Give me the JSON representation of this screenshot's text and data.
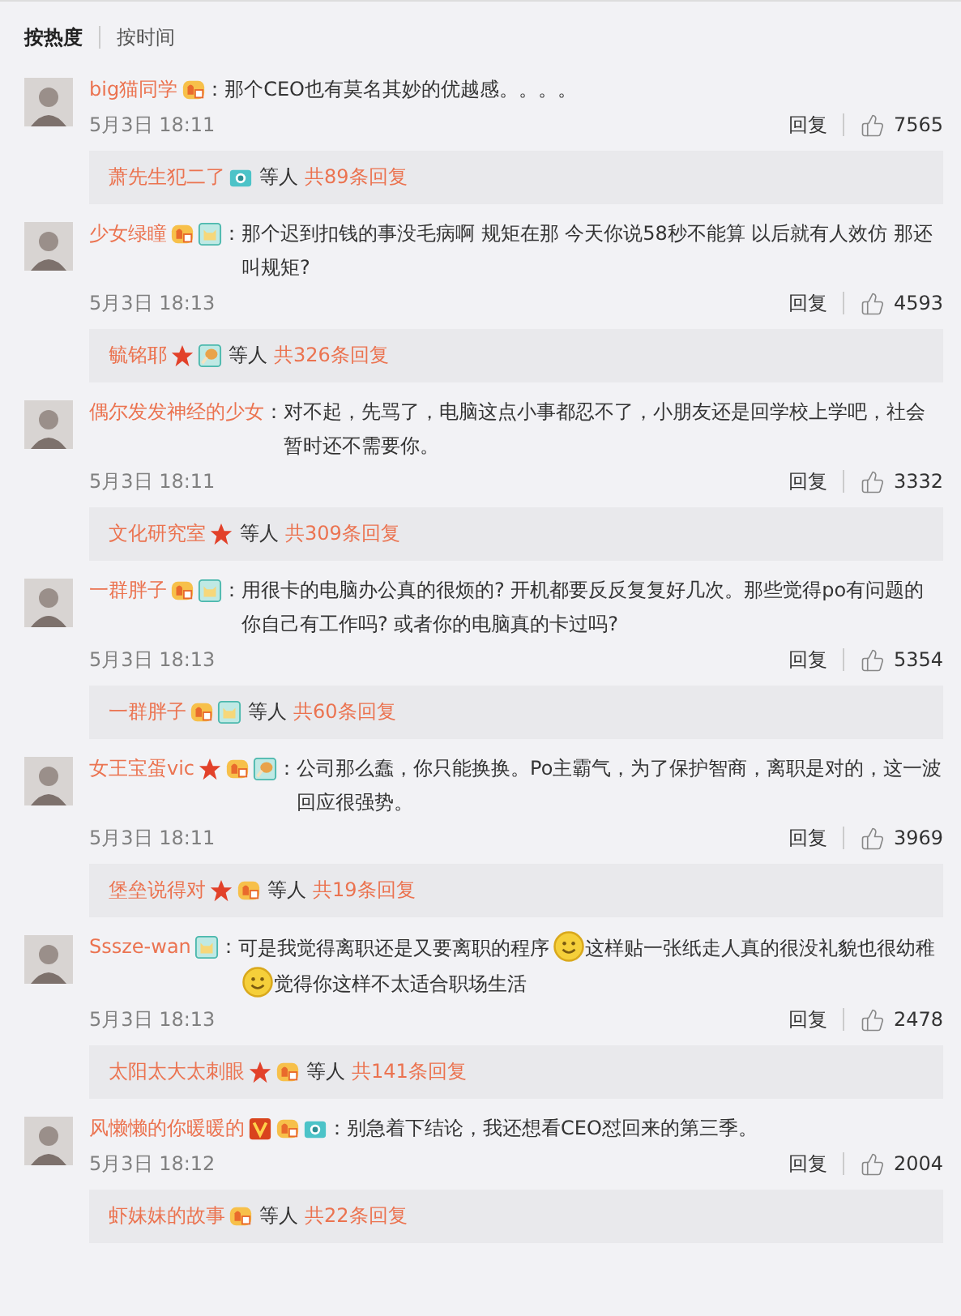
{
  "sort_tabs": [
    {
      "label": "按热度",
      "selected": true
    },
    {
      "label": "按时间",
      "selected": false
    }
  ],
  "comments": [
    {
      "user": "big猫同学",
      "badges": [
        {
          "kind": "fan"
        }
      ],
      "colon": "：",
      "text": [
        {
          "kind": "text",
          "value": "那个CEO也有莫名其妙的优越感。。。。"
        }
      ],
      "time": "5月3日 18:11",
      "reply": "回复",
      "likes": "7565",
      "thread": {
        "user": "萧先生犯二了",
        "badges": [
          {
            "kind": "camera"
          }
        ],
        "suffix": "等人",
        "count": "共89条回复"
      }
    },
    {
      "user": "少女绿瞳",
      "badges": [
        {
          "kind": "fan"
        },
        {
          "kind": "cat"
        }
      ],
      "colon": "：",
      "text": [
        {
          "kind": "text",
          "value": "那个迟到扣钱的事没毛病啊 规矩在那 今天你说58秒不能算 以后就有人效仿 那还叫规矩?"
        }
      ],
      "time": "5月3日 18:13",
      "reply": "回复",
      "likes": "4593",
      "thread": {
        "user": "毓铭耶",
        "badges": [
          {
            "kind": "star"
          },
          {
            "kind": "drumstick"
          }
        ],
        "suffix": "等人",
        "count": "共326条回复"
      }
    },
    {
      "user": "偶尔发发神经的少女",
      "colon": "：",
      "text": [
        {
          "kind": "text",
          "value": "对不起，先骂了，电脑这点小事都忍不了，小朋友还是回学校上学吧，社会暂时还不需要你。"
        }
      ],
      "time": "5月3日 18:11",
      "reply": "回复",
      "likes": "3332",
      "thread": {
        "user": "文化研究室",
        "badges": [
          {
            "kind": "star"
          }
        ],
        "suffix": "等人",
        "count": "共309条回复"
      }
    },
    {
      "user": "一群胖子",
      "badges": [
        {
          "kind": "fan"
        },
        {
          "kind": "cat"
        }
      ],
      "colon": "：",
      "text": [
        {
          "kind": "text",
          "value": "用很卡的电脑办公真的很烦的? 开机都要反反复复好几次。那些觉得po有问题的你自己有工作吗? 或者你的电脑真的卡过吗?"
        }
      ],
      "time": "5月3日 18:13",
      "reply": "回复",
      "likes": "5354",
      "thread": {
        "user": "一群胖子",
        "badges": [
          {
            "kind": "fan"
          },
          {
            "kind": "cat"
          }
        ],
        "suffix": "等人",
        "count": "共60条回复"
      }
    },
    {
      "user": "女王宝蛋vic",
      "badges": [
        {
          "kind": "star"
        },
        {
          "kind": "fan"
        },
        {
          "kind": "drumstick"
        }
      ],
      "colon": "：",
      "text": [
        {
          "kind": "text",
          "value": "公司那么蠢，你只能换换。Po主霸气，为了保护智商，离职是对的，这一波回应很强势。"
        }
      ],
      "time": "5月3日 18:11",
      "reply": "回复",
      "likes": "3969",
      "thread": {
        "user": "堡垒说得对",
        "badges": [
          {
            "kind": "star"
          },
          {
            "kind": "fan"
          }
        ],
        "suffix": "等人",
        "count": "共19条回复"
      }
    },
    {
      "user": "Sssze-wan",
      "badges": [
        {
          "kind": "cat"
        }
      ],
      "colon": "：",
      "text": [
        {
          "kind": "text",
          "value": "可是我觉得离职还是又要离职的程序"
        },
        {
          "kind": "smiley"
        },
        {
          "kind": "text",
          "value": "这样贴一张纸走人真的很没礼貌也很幼稚"
        },
        {
          "kind": "smiley"
        },
        {
          "kind": "text",
          "value": "觉得你这样不太适合职场生活"
        }
      ],
      "time": "5月3日 18:13",
      "reply": "回复",
      "likes": "2478",
      "thread": {
        "user": "太阳太大太刺眼",
        "badges": [
          {
            "kind": "star"
          },
          {
            "kind": "fan"
          }
        ],
        "suffix": "等人",
        "count": "共141条回复"
      }
    },
    {
      "user": "风懒懒的你暖暖的",
      "badges": [
        {
          "kind": "vip"
        },
        {
          "kind": "fan"
        },
        {
          "kind": "camera"
        }
      ],
      "colon": "：",
      "text": [
        {
          "kind": "text",
          "value": "别急着下结论，我还想看CEO怼回来的第三季。"
        }
      ],
      "time": "5月3日 18:12",
      "reply": "回复",
      "likes": "2004",
      "thread": {
        "user": "虾妹妹的故事",
        "badges": [
          {
            "kind": "fan"
          }
        ],
        "suffix": "等人",
        "count": "共22条回复"
      }
    }
  ]
}
